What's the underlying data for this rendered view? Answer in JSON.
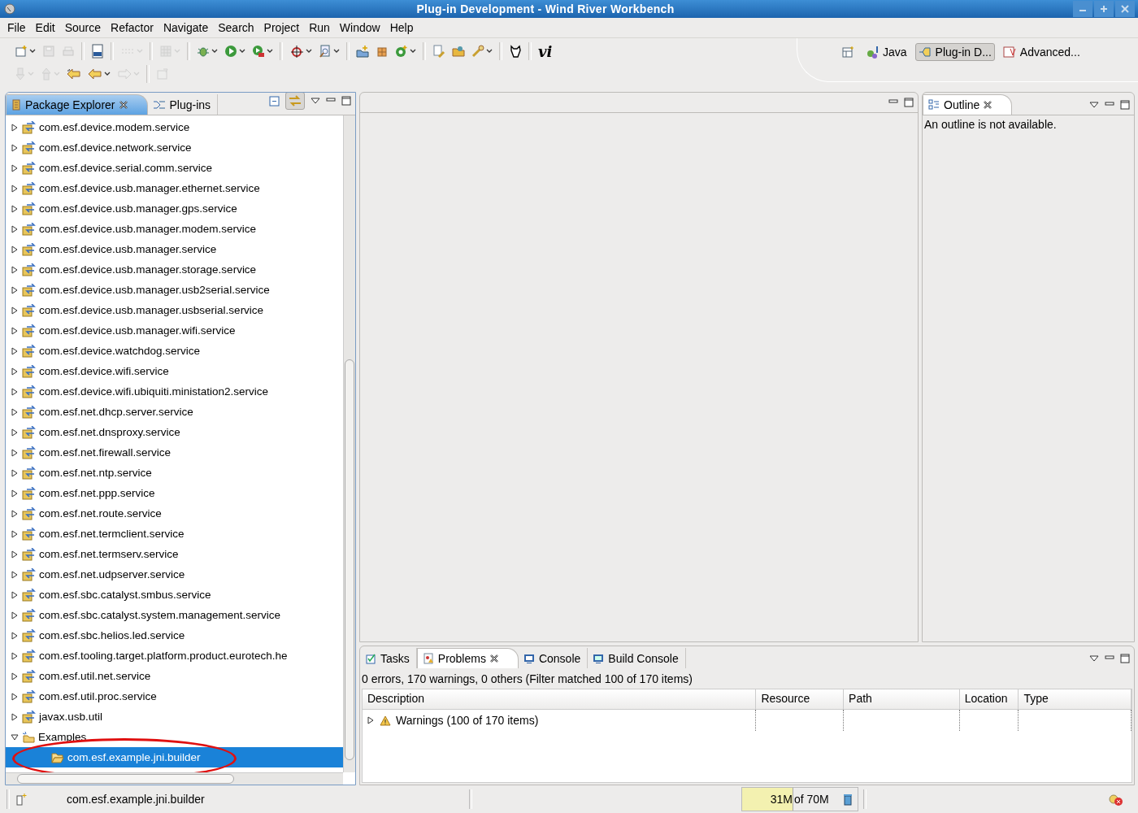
{
  "window": {
    "title": "Plug-in Development - Wind River Workbench"
  },
  "menu": [
    "File",
    "Edit",
    "Source",
    "Refactor",
    "Navigate",
    "Search",
    "Project",
    "Run",
    "Window",
    "Help"
  ],
  "toolbar": {
    "rows": [
      [
        {
          "kind": "button",
          "disabled": false,
          "dropdown": true
        },
        {
          "kind": "button",
          "disabled": true,
          "dropdown": false
        },
        {
          "kind": "button",
          "disabled": true,
          "dropdown": false
        },
        {
          "kind": "separator"
        },
        {
          "kind": "button",
          "disabled": false,
          "dropdown": false
        },
        {
          "kind": "separator"
        },
        {
          "kind": "button",
          "disabled": true,
          "dropdown": true
        },
        {
          "kind": "separator"
        },
        {
          "kind": "button",
          "disabled": true,
          "dropdown": true
        },
        {
          "kind": "separator"
        },
        {
          "kind": "button",
          "disabled": false,
          "dropdown": true
        },
        {
          "kind": "button",
          "disabled": false,
          "dropdown": true
        },
        {
          "kind": "button",
          "disabled": false,
          "dropdown": true
        },
        {
          "kind": "separator"
        },
        {
          "kind": "button",
          "disabled": false,
          "dropdown": true
        },
        {
          "kind": "button",
          "disabled": false,
          "dropdown": true
        },
        {
          "kind": "separator"
        },
        {
          "kind": "button",
          "disabled": false,
          "dropdown": false
        },
        {
          "kind": "button",
          "disabled": false,
          "dropdown": false
        },
        {
          "kind": "button",
          "disabled": false,
          "dropdown": true
        },
        {
          "kind": "separator"
        },
        {
          "kind": "button",
          "disabled": false,
          "dropdown": false
        },
        {
          "kind": "button",
          "disabled": false,
          "dropdown": false
        },
        {
          "kind": "button",
          "disabled": false,
          "dropdown": true
        },
        {
          "kind": "separator"
        },
        {
          "kind": "button",
          "disabled": false,
          "dropdown": false
        },
        {
          "kind": "separator"
        },
        {
          "kind": "text",
          "label": "vi"
        }
      ],
      [
        {
          "kind": "button",
          "disabled": true,
          "dropdown": true
        },
        {
          "kind": "button",
          "disabled": true,
          "dropdown": true
        },
        {
          "kind": "button",
          "disabled": false,
          "dropdown": false
        },
        {
          "kind": "button",
          "disabled": false,
          "dropdown": true
        },
        {
          "kind": "button",
          "disabled": true,
          "dropdown": true
        },
        {
          "kind": "separator"
        },
        {
          "kind": "button",
          "disabled": true,
          "dropdown": false
        }
      ]
    ]
  },
  "perspectives": [
    {
      "label": "Java",
      "selected": false
    },
    {
      "label": "Plug-in D...",
      "selected": true
    },
    {
      "label": "Advanced...",
      "selected": false
    }
  ],
  "package_explorer": {
    "active": true,
    "link_with_editor": true,
    "tabs": [
      {
        "label": "Package Explorer",
        "selected": true,
        "closable": true
      },
      {
        "label": "Plug-ins",
        "selected": false,
        "closable": false
      }
    ],
    "tree": [
      {
        "label": "com.esf.device.modem.service",
        "kind": "plugin",
        "expanded": false,
        "selected": false
      },
      {
        "label": "com.esf.device.network.service",
        "kind": "plugin",
        "expanded": false,
        "selected": false
      },
      {
        "label": "com.esf.device.serial.comm.service",
        "kind": "plugin",
        "expanded": false,
        "selected": false
      },
      {
        "label": "com.esf.device.usb.manager.ethernet.service",
        "kind": "plugin",
        "expanded": false,
        "selected": false
      },
      {
        "label": "com.esf.device.usb.manager.gps.service",
        "kind": "plugin",
        "expanded": false,
        "selected": false
      },
      {
        "label": "com.esf.device.usb.manager.modem.service",
        "kind": "plugin",
        "expanded": false,
        "selected": false
      },
      {
        "label": "com.esf.device.usb.manager.service",
        "kind": "plugin",
        "expanded": false,
        "selected": false
      },
      {
        "label": "com.esf.device.usb.manager.storage.service",
        "kind": "plugin",
        "expanded": false,
        "selected": false
      },
      {
        "label": "com.esf.device.usb.manager.usb2serial.service",
        "kind": "plugin",
        "expanded": false,
        "selected": false
      },
      {
        "label": "com.esf.device.usb.manager.usbserial.service",
        "kind": "plugin",
        "expanded": false,
        "selected": false
      },
      {
        "label": "com.esf.device.usb.manager.wifi.service",
        "kind": "plugin",
        "expanded": false,
        "selected": false
      },
      {
        "label": "com.esf.device.watchdog.service",
        "kind": "plugin",
        "expanded": false,
        "selected": false
      },
      {
        "label": "com.esf.device.wifi.service",
        "kind": "plugin",
        "expanded": false,
        "selected": false
      },
      {
        "label": "com.esf.device.wifi.ubiquiti.ministation2.service",
        "kind": "plugin",
        "expanded": false,
        "selected": false
      },
      {
        "label": "com.esf.net.dhcp.server.service",
        "kind": "plugin",
        "expanded": false,
        "selected": false
      },
      {
        "label": "com.esf.net.dnsproxy.service",
        "kind": "plugin",
        "expanded": false,
        "selected": false
      },
      {
        "label": "com.esf.net.firewall.service",
        "kind": "plugin",
        "expanded": false,
        "selected": false
      },
      {
        "label": "com.esf.net.ntp.service",
        "kind": "plugin",
        "expanded": false,
        "selected": false
      },
      {
        "label": "com.esf.net.ppp.service",
        "kind": "plugin",
        "expanded": false,
        "selected": false
      },
      {
        "label": "com.esf.net.route.service",
        "kind": "plugin",
        "expanded": false,
        "selected": false
      },
      {
        "label": "com.esf.net.termclient.service",
        "kind": "plugin",
        "expanded": false,
        "selected": false
      },
      {
        "label": "com.esf.net.termserv.service",
        "kind": "plugin",
        "expanded": false,
        "selected": false
      },
      {
        "label": "com.esf.net.udpserver.service",
        "kind": "plugin",
        "expanded": false,
        "selected": false
      },
      {
        "label": "com.esf.sbc.catalyst.smbus.service",
        "kind": "plugin",
        "expanded": false,
        "selected": false
      },
      {
        "label": "com.esf.sbc.catalyst.system.management.service",
        "kind": "plugin",
        "expanded": false,
        "selected": false
      },
      {
        "label": "com.esf.sbc.helios.led.service",
        "kind": "plugin",
        "expanded": false,
        "selected": false
      },
      {
        "label": "com.esf.tooling.target.platform.product.eurotech.he",
        "kind": "plugin",
        "expanded": false,
        "selected": false
      },
      {
        "label": "com.esf.util.net.service",
        "kind": "plugin",
        "expanded": false,
        "selected": false
      },
      {
        "label": "com.esf.util.proc.service",
        "kind": "plugin",
        "expanded": false,
        "selected": false
      },
      {
        "label": "javax.usb.util",
        "kind": "plugin",
        "expanded": false,
        "selected": false
      },
      {
        "label": "Examples",
        "kind": "working-set",
        "expanded": true,
        "selected": false,
        "children": [
          {
            "label": "com.esf.example.jni.builder",
            "kind": "project",
            "selected": true,
            "circled": true
          }
        ]
      }
    ]
  },
  "outline": {
    "tabs": [
      {
        "label": "Outline",
        "selected": true,
        "closable": true
      }
    ],
    "message": "An outline is not available."
  },
  "problems": {
    "tabs": [
      {
        "label": "Tasks",
        "selected": false,
        "closable": false
      },
      {
        "label": "Problems",
        "selected": true,
        "closable": true
      },
      {
        "label": "Console",
        "selected": false,
        "closable": false
      },
      {
        "label": "Build Console",
        "selected": false,
        "closable": false
      }
    ],
    "summary": "0 errors, 170 warnings, 0 others (Filter matched 100 of 170 items)",
    "columns": [
      "Description",
      "Resource",
      "Path",
      "Location",
      "Type"
    ],
    "rows": [
      {
        "description": "Warnings (100 of 170 items)",
        "kind": "warning",
        "expanded": false
      }
    ]
  },
  "status_bar": {
    "selection": "com.esf.example.jni.builder",
    "heap": {
      "used": "31M",
      "total": "of 70M",
      "level": 0.44
    }
  }
}
